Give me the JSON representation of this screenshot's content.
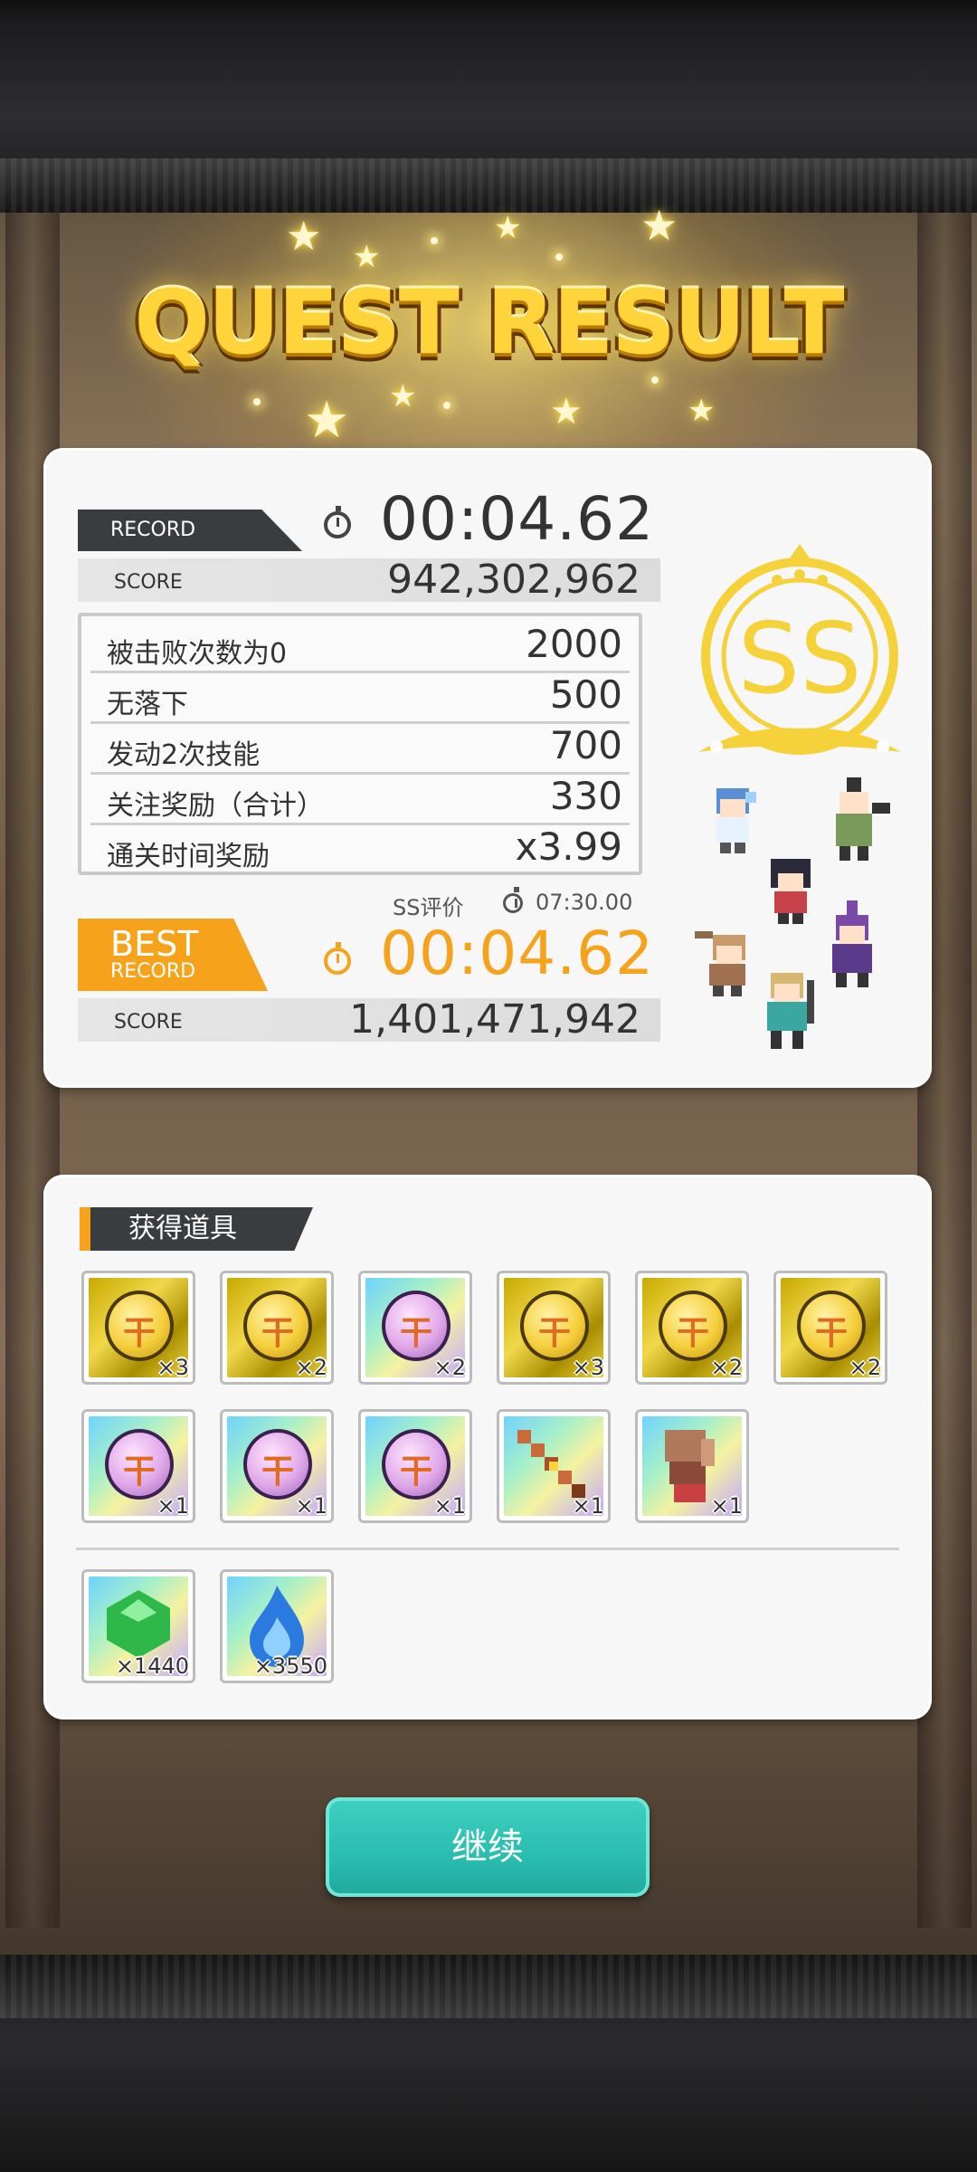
{
  "title": "QUEST RESULT",
  "record": {
    "tag": "RECORD",
    "time": "00:04.62",
    "score_label": "SCORE",
    "score": "942,302,962"
  },
  "bonuses": [
    {
      "name": "被击败次数为0",
      "value": "2000"
    },
    {
      "name": "无落下",
      "value": "500"
    },
    {
      "name": "发动2次技能",
      "value": "700"
    },
    {
      "name": "关注奖励（合计）",
      "value": "330"
    },
    {
      "name": "通关时间奖励",
      "value": "x3.99"
    }
  ],
  "ss_rating": {
    "label": "SS评价",
    "time": "07:30.00",
    "grade": "SS"
  },
  "best": {
    "tag_top": "BEST",
    "tag_bottom": "RECORD",
    "time": "00:04.62",
    "score_label": "SCORE",
    "score": "1,401,471,942"
  },
  "items": {
    "header": "获得道具",
    "row1": [
      {
        "icon": "gold-coin-icon",
        "qty": "×3"
      },
      {
        "icon": "gold-coin-icon",
        "qty": "×2"
      },
      {
        "icon": "purple-coin-icon",
        "qty": "×2"
      },
      {
        "icon": "gold-coin-icon",
        "qty": "×3"
      },
      {
        "icon": "gold-coin-icon",
        "qty": "×2"
      },
      {
        "icon": "gold-coin-icon",
        "qty": "×2"
      }
    ],
    "row2": [
      {
        "icon": "purple-coin-icon",
        "qty": "×1"
      },
      {
        "icon": "purple-coin-icon",
        "qty": "×1"
      },
      {
        "icon": "purple-coin-icon",
        "qty": "×1"
      },
      {
        "icon": "bow-weapon-icon",
        "qty": "×1"
      },
      {
        "icon": "gauntlet-weapon-icon",
        "qty": "×1"
      }
    ],
    "currency": [
      {
        "icon": "green-gem-icon",
        "qty": "×1440"
      },
      {
        "icon": "blue-flame-icon",
        "qty": "×3550"
      }
    ]
  },
  "continue_label": "继续",
  "colors": {
    "accent_orange": "#f7a21b",
    "button_teal": "#29bdb0",
    "title_gold": "#ffd43a"
  }
}
